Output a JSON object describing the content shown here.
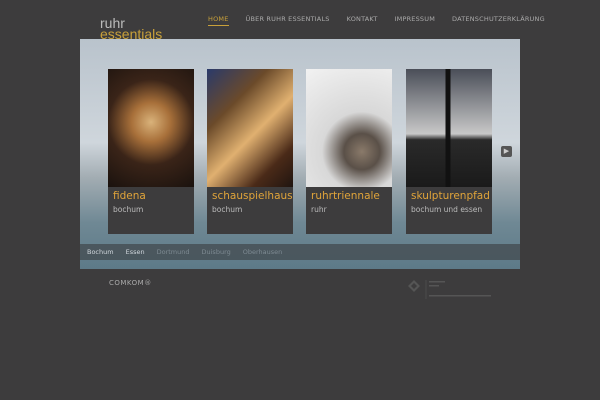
{
  "logo": {
    "line1": "ruhr",
    "line2": "essentials"
  },
  "nav": [
    {
      "label": "HOME",
      "active": true
    },
    {
      "label": "ÜBER RUHR ESSENTIALS"
    },
    {
      "label": "KONTAKT"
    },
    {
      "label": "IMPRESSUM"
    },
    {
      "label": "DATENSCHUTZERKLÄRUNG"
    }
  ],
  "cards": [
    {
      "title": "fidena",
      "subtitle": "bochum"
    },
    {
      "title": "schauspielhaus",
      "subtitle": "bochum"
    },
    {
      "title": "ruhrtriennale",
      "subtitle": "ruhr"
    },
    {
      "title": "skulpturenpfad",
      "subtitle": "bochum und essen"
    }
  ],
  "next_icon": "chevron-right-icon",
  "city_tabs": [
    {
      "label": "Bochum"
    },
    {
      "label": "Essen"
    },
    {
      "label": "Dortmund",
      "dim": true
    },
    {
      "label": "Duisburg",
      "dim": true
    },
    {
      "label": "Oberhausen",
      "dim": true
    }
  ],
  "footer": {
    "brand": "COMKOM®"
  },
  "colors": {
    "accent": "#c9a13a",
    "background": "#3d3c3d"
  }
}
